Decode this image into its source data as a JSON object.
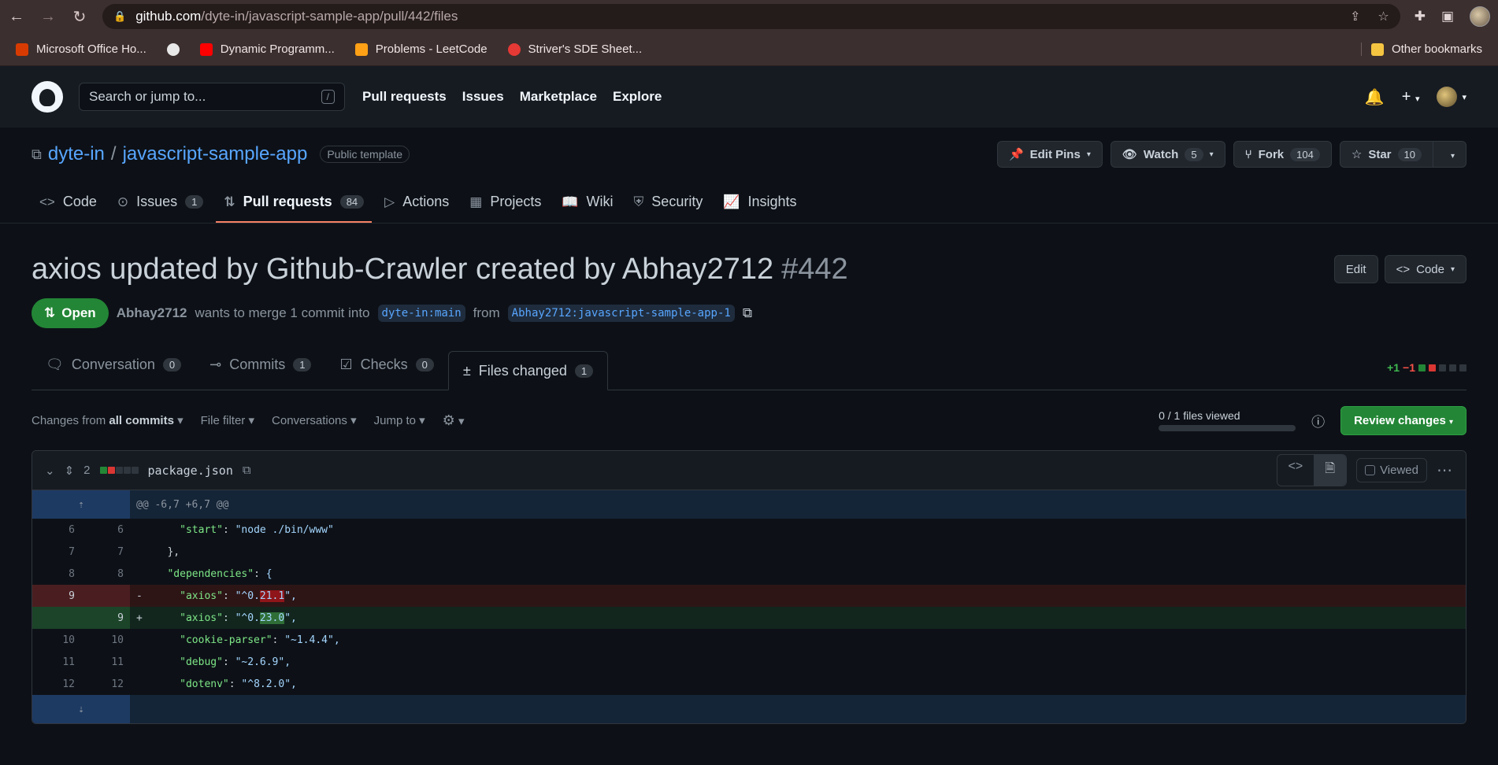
{
  "browser": {
    "url_host": "github.com",
    "url_path": "/dyte-in/javascript-sample-app/pull/442/files",
    "bookmarks": [
      {
        "label": "Microsoft Office Ho...",
        "color": "#d83b01"
      },
      {
        "label": "",
        "color": "#e8e8e8"
      },
      {
        "label": "Dynamic Programm...",
        "color": "#ff0000"
      },
      {
        "label": "Problems - LeetCode",
        "color": "#ffa116"
      },
      {
        "label": "Striver's SDE Sheet...",
        "color": "#e53935"
      }
    ],
    "other_bookmarks": "Other bookmarks"
  },
  "gh_header": {
    "search_placeholder": "Search or jump to...",
    "search_key": "/",
    "nav": [
      "Pull requests",
      "Issues",
      "Marketplace",
      "Explore"
    ],
    "plus": "+"
  },
  "repo": {
    "owner": "dyte-in",
    "separator": "/",
    "name": "javascript-sample-app",
    "visibility": "Public template",
    "edit_pins": "Edit Pins",
    "watch": "Watch",
    "watch_count": "5",
    "fork": "Fork",
    "fork_count": "104",
    "star": "Star",
    "star_count": "10",
    "tabs": [
      {
        "label": "Code",
        "icon": "<>",
        "count": ""
      },
      {
        "label": "Issues",
        "icon": "⊙",
        "count": "1"
      },
      {
        "label": "Pull requests",
        "icon": "⇅",
        "count": "84"
      },
      {
        "label": "Actions",
        "icon": "▷",
        "count": ""
      },
      {
        "label": "Projects",
        "icon": "▦",
        "count": ""
      },
      {
        "label": "Wiki",
        "icon": "📖",
        "count": ""
      },
      {
        "label": "Security",
        "icon": "⛨",
        "count": ""
      },
      {
        "label": "Insights",
        "icon": "📈",
        "count": ""
      }
    ]
  },
  "pr": {
    "title": "axios updated by Github-Crawler created by Abhay2712",
    "number": "#442",
    "edit": "Edit",
    "code": "Code",
    "state": "Open",
    "author": "Abhay2712",
    "merge_text": "wants to merge 1 commit into",
    "base": "dyte-in:main",
    "from": "from",
    "head": "Abhay2712:javascript-sample-app-1",
    "tabs": [
      {
        "label": "Conversation",
        "icon": "💬",
        "count": "0"
      },
      {
        "label": "Commits",
        "icon": "-o-",
        "count": "1"
      },
      {
        "label": "Checks",
        "icon": "☑",
        "count": "0"
      },
      {
        "label": "Files changed",
        "icon": "±",
        "count": "1"
      }
    ],
    "diffstat_add": "+1",
    "diffstat_del": "−1"
  },
  "toolbar": {
    "changes_from": "Changes from",
    "all_commits": "all commits",
    "file_filter": "File filter",
    "conversations": "Conversations",
    "jump_to": "Jump to",
    "files_viewed": "0 / 1 files viewed",
    "files_viewed_fraction": 0,
    "review_changes": "Review changes"
  },
  "file": {
    "changes": "2",
    "name": "package.json",
    "viewed": "Viewed",
    "hunk": "@@ -6,7 +6,7 @@",
    "lines": [
      {
        "type": "ctx",
        "old": "6",
        "new": "6",
        "sign": "",
        "indent": "    ",
        "key": "\"start\"",
        "sep": ": ",
        "pre": "",
        "hl": "",
        "post": "\"node ./bin/www\""
      },
      {
        "type": "ctx",
        "old": "7",
        "new": "7",
        "sign": "",
        "indent": "  ",
        "key": "",
        "sep": "",
        "pre": "",
        "hl": "",
        "post": "},"
      },
      {
        "type": "ctx",
        "old": "8",
        "new": "8",
        "sign": "",
        "indent": "  ",
        "key": "\"dependencies\"",
        "sep": ": ",
        "pre": "",
        "hl": "",
        "post": "{"
      },
      {
        "type": "del",
        "old": "9",
        "new": "",
        "sign": "-",
        "indent": "    ",
        "key": "\"axios\"",
        "sep": ": ",
        "pre": "\"^0.",
        "hl": "21.1",
        "post": "\","
      },
      {
        "type": "add",
        "old": "",
        "new": "9",
        "sign": "+",
        "indent": "    ",
        "key": "\"axios\"",
        "sep": ": ",
        "pre": "\"^0.",
        "hl": "23.0",
        "post": "\","
      },
      {
        "type": "ctx",
        "old": "10",
        "new": "10",
        "sign": "",
        "indent": "    ",
        "key": "\"cookie-parser\"",
        "sep": ": ",
        "pre": "",
        "hl": "",
        "post": "\"~1.4.4\","
      },
      {
        "type": "ctx",
        "old": "11",
        "new": "11",
        "sign": "",
        "indent": "    ",
        "key": "\"debug\"",
        "sep": ": ",
        "pre": "",
        "hl": "",
        "post": "\"~2.6.9\","
      },
      {
        "type": "ctx",
        "old": "12",
        "new": "12",
        "sign": "",
        "indent": "    ",
        "key": "\"dotenv\"",
        "sep": ": ",
        "pre": "",
        "hl": "",
        "post": "\"^8.2.0\","
      }
    ]
  },
  "colors": {
    "accent": "#58a6ff",
    "success": "#238636",
    "danger": "#f85149",
    "tab_underline": "#f78166"
  }
}
